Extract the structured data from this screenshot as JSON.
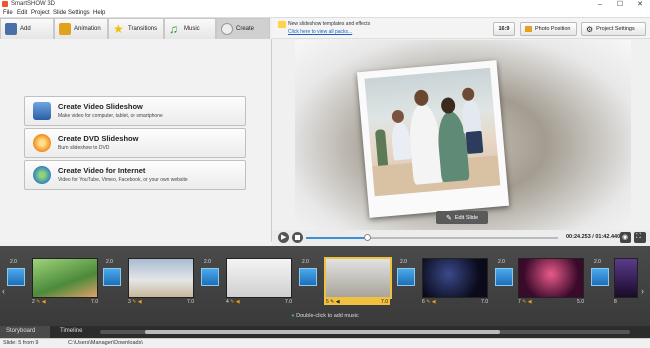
{
  "window": {
    "title": "SmartSHOW 3D"
  },
  "menu": [
    "File",
    "Edit",
    "Project",
    "Slide",
    "Settings",
    "Help"
  ],
  "tabs": [
    {
      "label": "Add",
      "icon": "add-icon"
    },
    {
      "label": "Animation",
      "icon": "animation-icon"
    },
    {
      "label": "Transitions",
      "icon": "transitions-icon"
    },
    {
      "label": "Music",
      "icon": "music-icon"
    },
    {
      "label": "Create",
      "icon": "create-icon"
    }
  ],
  "notice": {
    "line1": "New slideshow templates and effects",
    "line2": "Click here to view all packs..."
  },
  "toolbar": {
    "aspect": "16:9",
    "photo_position": "Photo Position",
    "project_settings": "Project Settings"
  },
  "create_options": [
    {
      "title": "Create Video Slideshow",
      "desc": "Make video for computer, tablet, or smartphone"
    },
    {
      "title": "Create DVD Slideshow",
      "desc": "Burn slideshow to DVD"
    },
    {
      "title": "Create Video for Internet",
      "desc": "Video for YouTube, Vimeo, Facebook, or your own website"
    }
  ],
  "preview": {
    "edit_slide": "Edit Slide"
  },
  "player": {
    "time": "00:24.253 / 01:42.440"
  },
  "slides": [
    {
      "num": "2",
      "dur": "7.0"
    },
    {
      "num": "3",
      "dur": "7.0"
    },
    {
      "num": "4",
      "dur": "7.0"
    },
    {
      "num": "5",
      "dur": "7.0"
    },
    {
      "num": "6",
      "dur": "7.0"
    },
    {
      "num": "7",
      "dur": "5.0"
    },
    {
      "num": "8",
      "dur": ""
    }
  ],
  "transitions": [
    "2.0",
    "2.0",
    "2.0",
    "2.0",
    "2.0",
    "2.0",
    "2.0"
  ],
  "storyboard": {
    "add_music": "Double-click to add music"
  },
  "timeline_tabs": [
    "Storyboard",
    "Timeline"
  ],
  "status": {
    "slide": "Slide: 5 from 9",
    "path": "C:\\Users\\Manager\\Downloads\\"
  },
  "colors": {
    "accent": "#3a8fd6",
    "selected": "#f0c040",
    "storyboard_bg": "#3f3f3f"
  }
}
